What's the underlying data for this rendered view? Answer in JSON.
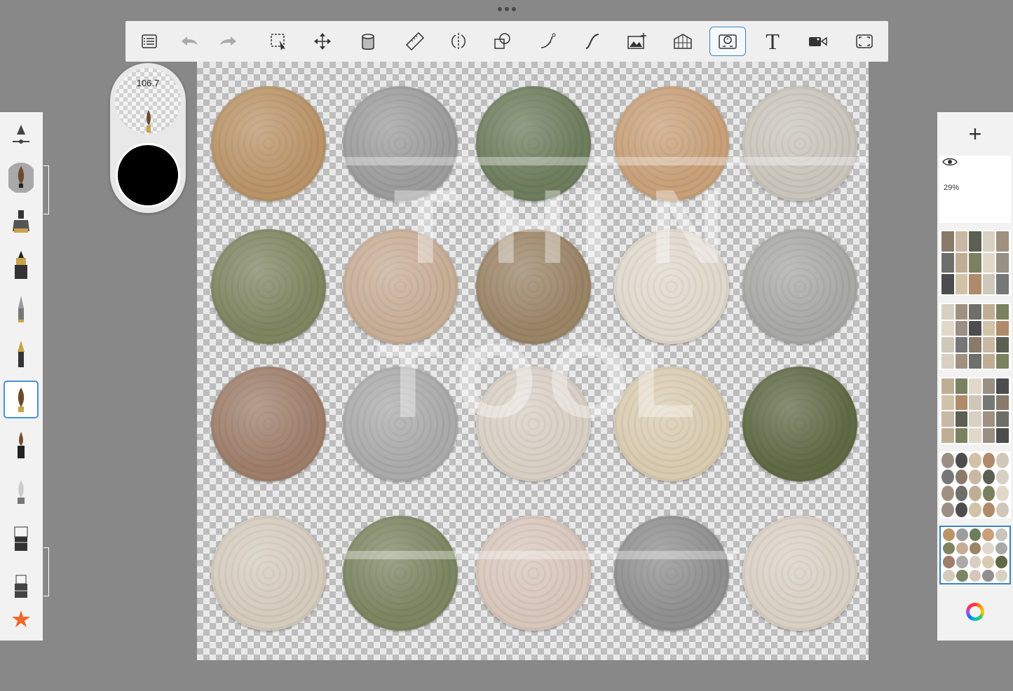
{
  "brush_puck": {
    "size_value": "106.7",
    "current_color": "#000000"
  },
  "layers": {
    "add_label": "+",
    "top_layer_opacity": "29%"
  },
  "toolbar": {
    "tools": [
      "list-icon",
      "undo-icon",
      "redo-icon",
      "selection-icon",
      "transform-icon",
      "fill-icon",
      "ruler-icon",
      "symmetry-icon",
      "shapes-icon",
      "curve-icon",
      "stroke-icon",
      "import-image-icon",
      "perspective-icon",
      "time-lapse-icon",
      "text-icon",
      "video-icon",
      "fullscreen-icon"
    ],
    "text_tool_label": "T"
  },
  "watermark": {
    "letters": [
      "T",
      "H",
      "I",
      "N",
      "T",
      "O",
      "O",
      "L"
    ]
  },
  "rug_colors": [
    [
      "#b99468",
      "#9c9c9c",
      "#6e7d5d",
      "#c8a079",
      "#c9c5bc"
    ],
    [
      "#7f8561",
      "#c7ad96",
      "#9a8466",
      "#dfd8cc",
      "#a8a8a6"
    ],
    [
      "#9e7e6a",
      "#aaaaaa",
      "#d8cfc4",
      "#d9cbb0",
      "#5f6a45"
    ],
    [
      "#d5cbbd",
      "#7d8562",
      "#d8c6bb",
      "#8f8f8f",
      "#d9d0c4"
    ]
  ]
}
